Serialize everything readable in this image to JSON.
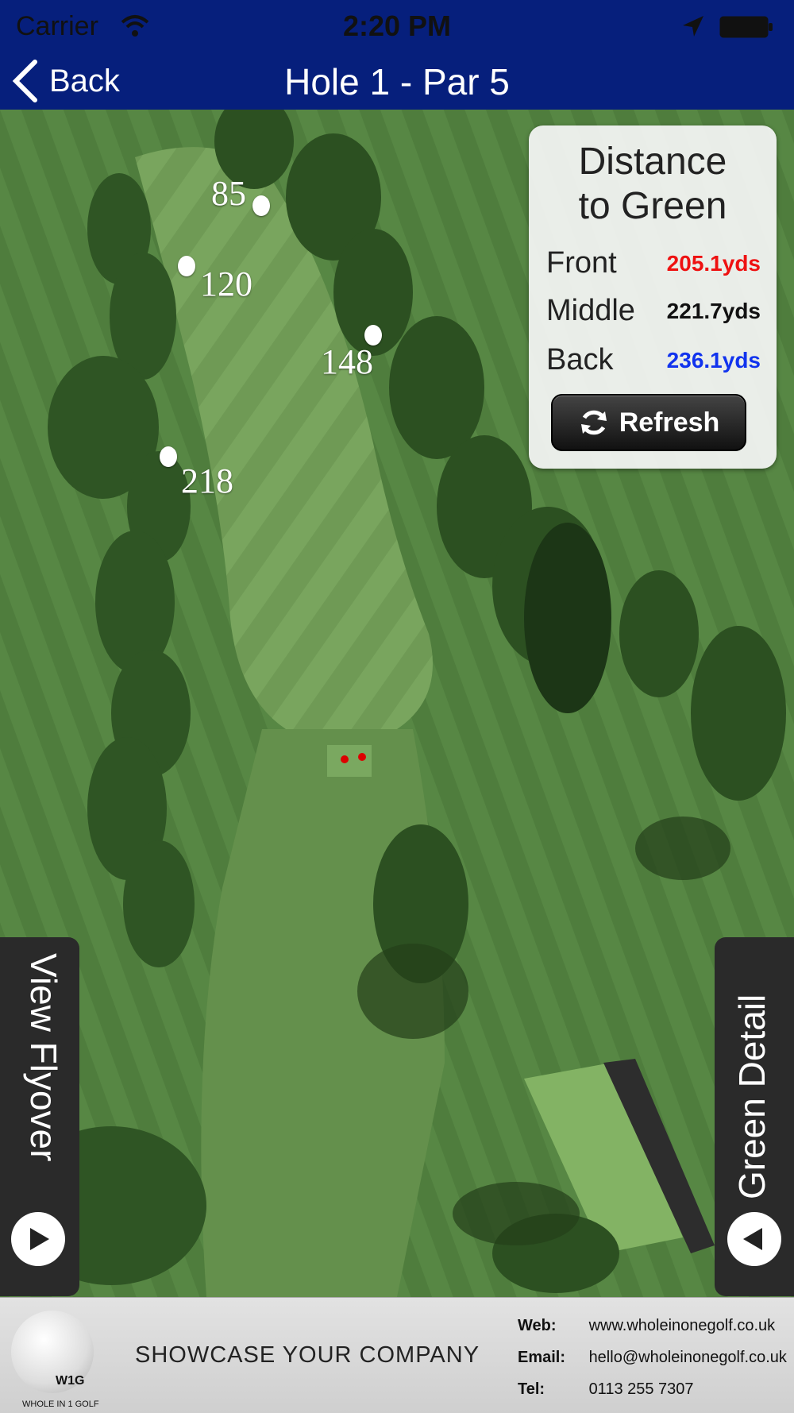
{
  "status_bar": {
    "carrier": "Carrier",
    "time": "2:20 PM"
  },
  "nav": {
    "back_label": "Back",
    "title": "Hole 1 - Par 5"
  },
  "yardage_markers": [
    "85",
    "120",
    "148",
    "218"
  ],
  "distance_panel": {
    "title_line1": "Distance",
    "title_line2": "to Green",
    "rows": [
      {
        "label": "Front",
        "value": "205.1yds",
        "color": "#ee1111"
      },
      {
        "label": "Middle",
        "value": "221.7yds",
        "color": "#111111"
      },
      {
        "label": "Back",
        "value": "236.1yds",
        "color": "#1133ee"
      }
    ],
    "refresh_label": "Refresh"
  },
  "side_tabs": {
    "left": "View Flyover",
    "right": "Green Detail"
  },
  "footer": {
    "logo_text": "W1G",
    "logo_sub": "WHOLE IN 1 GOLF",
    "tagline": "SHOWCASE YOUR COMPANY",
    "web_label": "Web:",
    "web": "www.wholeinonegolf.co.uk",
    "email_label": "Email:",
    "email": "hello@wholeinonegolf.co.uk",
    "tel_label": "Tel:",
    "tel": "0113 255 7307"
  },
  "colors": {
    "nav_bg": "#061f7c",
    "fairway": "#6f9a55",
    "rough": "#4e7a3c"
  }
}
